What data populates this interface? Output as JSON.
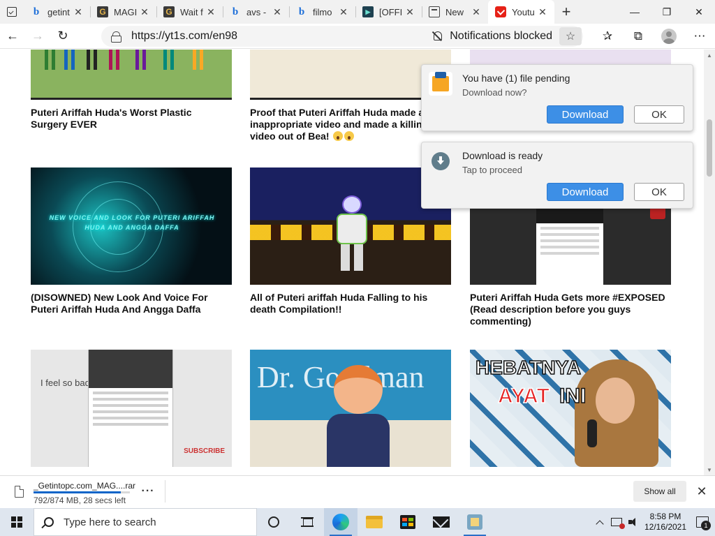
{
  "browser": {
    "tabs": [
      {
        "title": "getint",
        "favicon": "bing-icon",
        "active": false
      },
      {
        "title": "MAGI",
        "favicon": "g-icon",
        "active": false
      },
      {
        "title": "Wait f",
        "favicon": "g-icon",
        "active": false
      },
      {
        "title": "avs -",
        "favicon": "bing-icon",
        "active": false
      },
      {
        "title": "filmo",
        "favicon": "bing-icon",
        "active": false
      },
      {
        "title": "[OFFI",
        "favicon": "offline-icon",
        "active": false
      },
      {
        "title": "New",
        "favicon": "newtab-icon",
        "active": false
      },
      {
        "title": "Youtu",
        "favicon": "youtube-icon",
        "active": true
      }
    ],
    "url": "https://yt1s.com/en98",
    "notifications_label": "Notifications blocked"
  },
  "videos": [
    {
      "title": "Puteri Ariffah Huda's Worst Plastic Surgery EVER"
    },
    {
      "title": "Proof that Puteri Ariffah Huda made a inappropriate video and made a killing video out of Bea!"
    },
    {
      "title": ""
    },
    {
      "title": "(DISOWNED) New Look And Voice For Puteri Ariffah Huda And Angga Daffa",
      "overlay": "NEW VOICE AND LOOK FOR PUTERI ARIFFAH HUDA AND ANGGA DAFFA"
    },
    {
      "title": "All of Puteri ariffah Huda Falling to his death Compilation!!"
    },
    {
      "title": "Puteri Ariffah Huda Gets more #EXPOSED (Read description before you guys commenting)"
    },
    {
      "title": "",
      "overlay": "I feel so bad",
      "overlay2": "SUBSCRIBE"
    },
    {
      "title": "",
      "overlay": "Dr. Goodman"
    },
    {
      "title": "",
      "overlay": "HEBATNYA",
      "overlay2": "AYAT",
      "overlay3": "INI"
    }
  ],
  "popups": [
    {
      "title": "You have (1) file pending",
      "subtitle": "Download now?",
      "download_label": "Download",
      "ok_label": "OK"
    },
    {
      "title": "Download is ready",
      "subtitle": "Tap to proceed",
      "download_label": "Download",
      "ok_label": "OK"
    }
  ],
  "download_bar": {
    "filename": "_Getintopc.com_MAG....rar",
    "status": "792/874 MB, 28 secs left",
    "progress": 0.906,
    "show_all_label": "Show all"
  },
  "taskbar": {
    "search_placeholder": "Type here to search",
    "time": "8:58 PM",
    "date": "12/16/2021",
    "notification_count": "1"
  },
  "colors": {
    "accent": "#3d8fe6",
    "youtube_red": "#e62117",
    "progress": "#0a64c8"
  }
}
